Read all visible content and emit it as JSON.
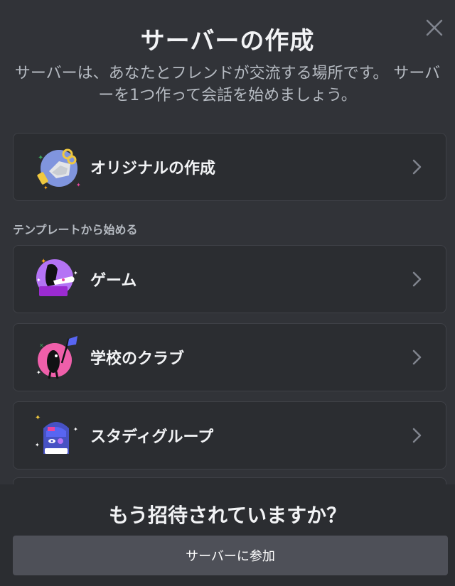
{
  "modal": {
    "title": "サーバーの作成",
    "subtitle": "サーバーは、あなたとフレンドが交流する場所です。 サーバーを1つ作って会話を始めましょう。"
  },
  "create_own": {
    "label": "オリジナルの作成"
  },
  "templates": {
    "heading": "テンプレートから始める",
    "items": [
      {
        "label": "ゲーム",
        "icon": "gaming-illustration-icon"
      },
      {
        "label": "学校のクラブ",
        "icon": "school-club-illustration-icon"
      },
      {
        "label": "スタディグループ",
        "icon": "study-group-illustration-icon"
      }
    ]
  },
  "footer": {
    "title": "もう招待されていますか？",
    "join_label": "サーバーに参加"
  },
  "colors": {
    "background": "#313338",
    "card": "#2b2d31",
    "button": "#4e5058",
    "muted_text": "#b5bac1"
  }
}
